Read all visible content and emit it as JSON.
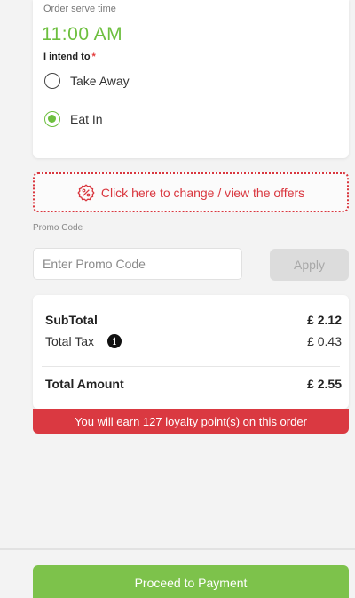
{
  "order": {
    "serve_label": "Order serve time",
    "serve_time": "11:00 AM",
    "intend_label": "I intend to",
    "required_mark": "*",
    "options": [
      {
        "label": "Take Away",
        "selected": false
      },
      {
        "label": "Eat In",
        "selected": true
      }
    ]
  },
  "offers": {
    "icon": "percent-badge-icon",
    "text": "Click here to change / view the offers"
  },
  "promo": {
    "label": "Promo Code",
    "placeholder": "Enter Promo Code",
    "value": "",
    "apply_label": "Apply"
  },
  "totals": {
    "subtotal_label": "SubTotal",
    "subtotal_value": "£ 2.12",
    "tax_label": "Total Tax",
    "tax_icon": "info-icon",
    "tax_value": "£ 0.43",
    "total_label": "Total Amount",
    "total_value": "£ 2.55"
  },
  "loyalty": {
    "text": "You will earn 127 loyalty point(s) on this order"
  },
  "footer": {
    "proceed_label": "Proceed to Payment"
  },
  "colors": {
    "accent_green": "#6dbf3f",
    "button_green": "#7dc24b",
    "alert_red": "#da3941"
  }
}
